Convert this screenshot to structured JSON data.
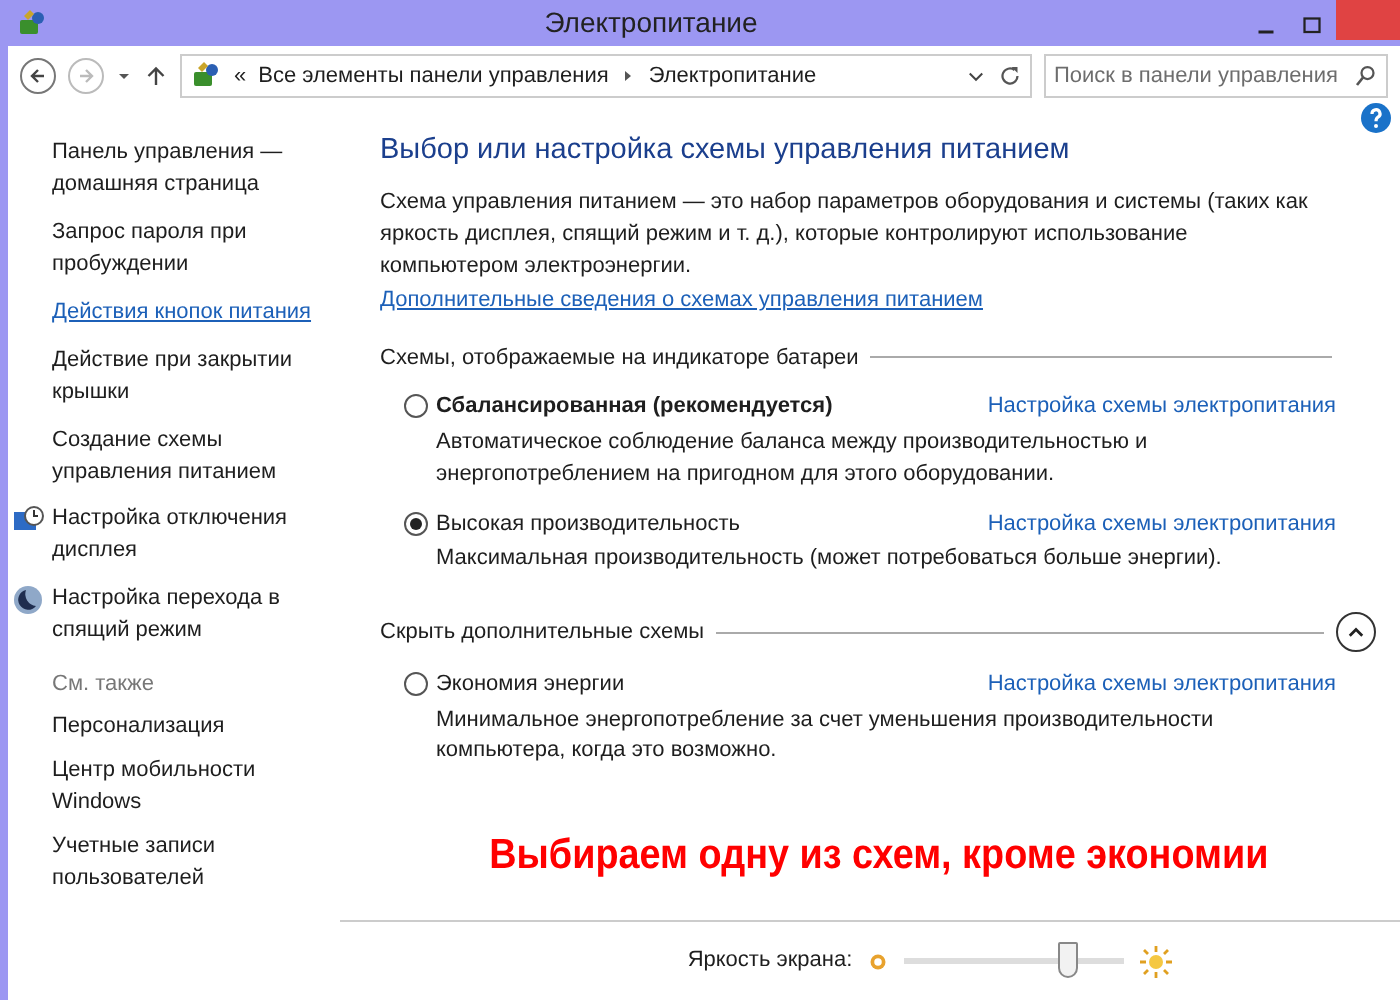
{
  "window": {
    "title": "Электропитание"
  },
  "address": {
    "overflow": "«",
    "crumbs": [
      "Все элементы панели управления",
      "Электропитание"
    ]
  },
  "search": {
    "placeholder": "Поиск в панели управления"
  },
  "sidebar": {
    "items": [
      {
        "label": "Панель управления — домашняя страница",
        "kind": "link",
        "selected": false
      },
      {
        "label": "Запрос пароля при пробуждении",
        "kind": "link",
        "selected": false
      },
      {
        "label": "Действия кнопок питания",
        "kind": "link",
        "selected": true
      },
      {
        "label": "Действие при закрытии крышки",
        "kind": "link",
        "selected": false
      },
      {
        "label": "Создание схемы управления питанием",
        "kind": "link",
        "selected": false
      },
      {
        "label": "Настройка отключения дисплея",
        "kind": "display",
        "selected": false
      },
      {
        "label": "Настройка перехода в спящий режим",
        "kind": "sleep",
        "selected": false
      }
    ],
    "see_also": {
      "heading": "См. также",
      "items": [
        "Персонализация",
        "Центр мобильности Windows",
        "Учетные записи пользователей"
      ]
    }
  },
  "main": {
    "heading": "Выбор или настройка схемы управления питанием",
    "intro": "Схема управления питанием — это набор параметров оборудования и системы (таких как яркость дисплея, спящий режим и т. д.), которые контролируют использование компьютером электроэнергии.",
    "more_link": "Дополнительные сведения о схемах управления питанием",
    "groups": [
      {
        "title": "Схемы, отображаемые на индикаторе батареи",
        "expanded": false,
        "plans": [
          {
            "name": "Сбалансированная (рекомендуется)",
            "bold": true,
            "selected": false,
            "link": "Настройка схемы электропитания",
            "description": "Автоматическое соблюдение баланса между производительностью и энергопотреблением на пригодном для этого оборудовании."
          },
          {
            "name": "Высокая производительность",
            "bold": false,
            "selected": true,
            "link": "Настройка схемы электропитания",
            "description": "Максимальная производительность (может потребоваться больше энергии)."
          }
        ]
      },
      {
        "title": "Скрыть дополнительные схемы",
        "expanded": true,
        "plans": [
          {
            "name": "Экономия энергии",
            "bold": false,
            "selected": false,
            "link": "Настройка схемы электропитания",
            "description": "Минимальное энергопотребление за счет уменьшения производительности компьютера, когда это возможно."
          }
        ]
      }
    ]
  },
  "annotation": "Выбираем одну из схем, кроме экономии",
  "brightness": {
    "label": "Яркость экрана:",
    "level": 0.74
  }
}
